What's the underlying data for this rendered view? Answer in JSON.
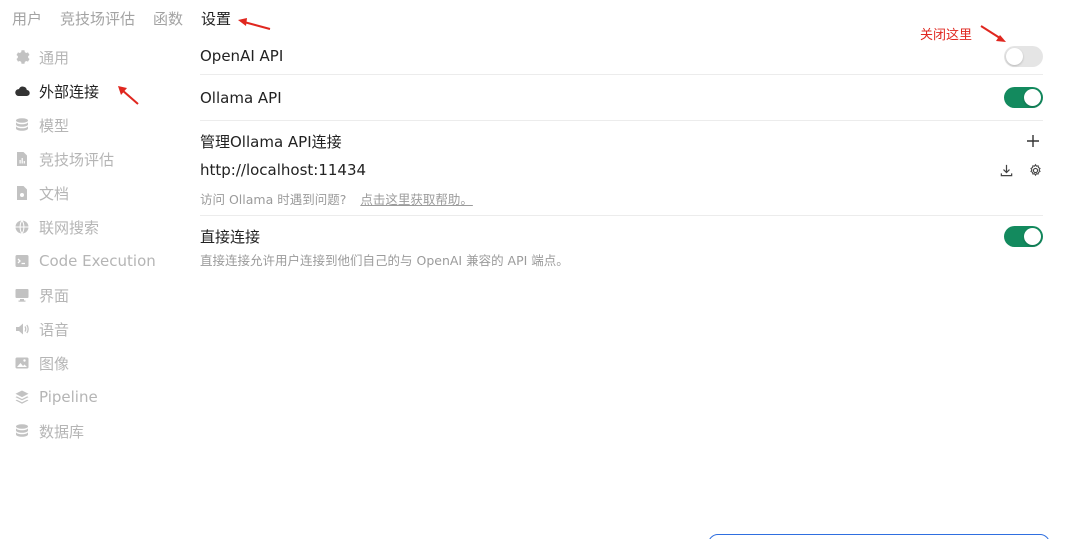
{
  "top_tabs": [
    {
      "label": "用户"
    },
    {
      "label": "竞技场评估"
    },
    {
      "label": "函数"
    },
    {
      "label": "设置"
    }
  ],
  "sidebar": {
    "items": [
      {
        "label": "通用",
        "icon": "gear-icon"
      },
      {
        "label": "外部连接",
        "icon": "cloud-icon"
      },
      {
        "label": "模型",
        "icon": "database-icon"
      },
      {
        "label": "竞技场评估",
        "icon": "document-chart-icon"
      },
      {
        "label": "文档",
        "icon": "document-icon"
      },
      {
        "label": "联网搜索",
        "icon": "globe-icon"
      },
      {
        "label": "Code Execution",
        "icon": "terminal-icon"
      },
      {
        "label": "界面",
        "icon": "monitor-icon"
      },
      {
        "label": "语音",
        "icon": "speaker-icon"
      },
      {
        "label": "图像",
        "icon": "image-icon"
      },
      {
        "label": "Pipeline",
        "icon": "layers-icon"
      },
      {
        "label": "数据库",
        "icon": "database-icon"
      }
    ],
    "active_index": 1
  },
  "settings": {
    "openai_api": {
      "label": "OpenAI API",
      "enabled": false
    },
    "ollama_api": {
      "label": "Ollama API",
      "enabled": true
    },
    "manage_ollama": {
      "title": "管理Ollama API连接",
      "url": "http://localhost:11434",
      "help_text": "访问 Ollama 时遇到问题?",
      "help_link": "点击这里获取帮助。"
    },
    "direct_connection": {
      "label": "直接连接",
      "enabled": true,
      "description": "直接连接允许用户连接到他们自己的与 OpenAI 兼容的 API 端点。"
    }
  },
  "annotations": {
    "close_here": "关闭这里"
  },
  "colors": {
    "toggle_on": "#138a5e",
    "toggle_off": "#e5e5e5",
    "annotation": "#e0271f"
  }
}
